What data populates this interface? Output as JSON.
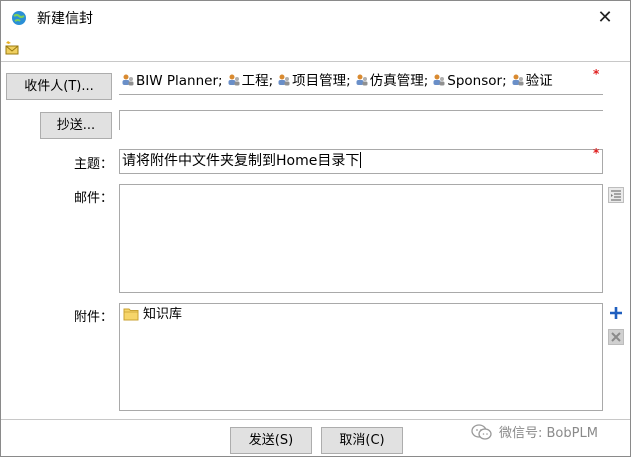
{
  "window": {
    "title": "新建信封",
    "close_label": "✕"
  },
  "to": {
    "button_label": "收件人(T)...",
    "recipients": [
      "BIW Planner;",
      "工程;",
      "项目管理;",
      "仿真管理;",
      "Sponsor;",
      "验证"
    ]
  },
  "cc": {
    "button_label": "抄送...",
    "value": ""
  },
  "subject": {
    "label": "主题：",
    "value": "请将附件中文件夹复制到Home目录下"
  },
  "body": {
    "label": "邮件：",
    "value": ""
  },
  "attachments": {
    "label": "附件：",
    "items": [
      "知识库"
    ]
  },
  "footer": {
    "send_label": "发送(S)",
    "cancel_label": "取消(C)"
  },
  "watermark": {
    "text": "微信号: BobPLM"
  },
  "required_marker": "*",
  "icons": {
    "app": "envelope-globe-icon",
    "toolbar": "new-envelope-icon",
    "recipient": "user-group-icon",
    "folder": "folder-icon",
    "add": "plus-icon",
    "remove": "x-icon",
    "body-side": "format-icon"
  },
  "colors": {
    "accent_blue": "#1f5fbf",
    "required_red": "#e02020",
    "button_bg": "#e1e1e1"
  }
}
